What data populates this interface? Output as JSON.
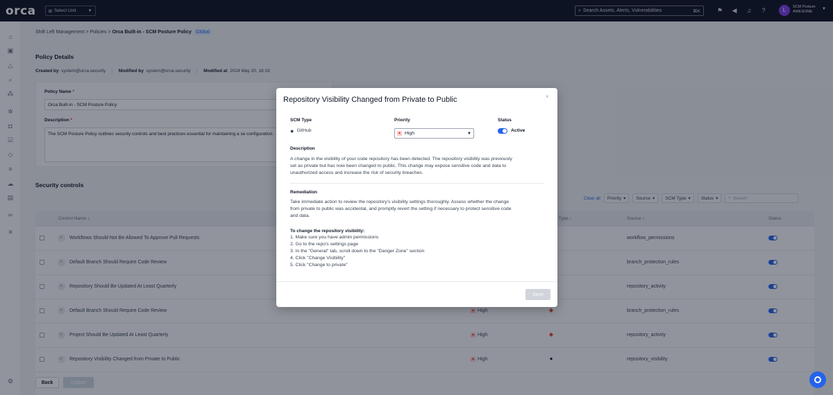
{
  "app": {
    "logo": "orca",
    "unit_select": "Select Unit"
  },
  "topbar": {
    "search_placeholder": "Search Assets, Alerts, Vulnerabilities",
    "search_shortcut": "⌘K",
    "user_initial": "L",
    "user_name": "SCM Posture",
    "user_org": "AWESOME"
  },
  "breadcrumb": {
    "item1": "Shift Left Management",
    "sep": ">",
    "item2": "Policies",
    "current": "Orca Built-in - SCM Posture Policy",
    "badge": "Global"
  },
  "policy_details": {
    "title": "Policy Details",
    "created_by_label": "Created by",
    "created_by": "system@orca.security",
    "modified_by_label": "Modified by",
    "modified_by": "system@orca.security",
    "modified_at_label": "Modified at",
    "modified_at": "2024 May 20, 18:18",
    "policy_name_label": "Policy Name",
    "policy_name": "Orca Built-in - SCM Posture Policy",
    "description_label": "Description",
    "description": "The SCM Posture Policy outlines security controls and best practices essential for maintaining a se configuration."
  },
  "security_controls": {
    "title": "Security controls",
    "clear_all": "Clear all",
    "filters": [
      "Priority",
      "Source",
      "SCM Type",
      "Status"
    ],
    "search_placeholder": "Search",
    "columns": {
      "name": "Control Name",
      "scm_type": "t Type",
      "source": "Source",
      "status": "Status"
    },
    "rows": [
      {
        "name": "Workflows Should Not Be Allowed To Approve Pull Requests",
        "priority": "",
        "scm_icon": "",
        "source": "workflow_permissions"
      },
      {
        "name": "Default Branch Should Require Code Review",
        "priority": "",
        "scm_icon": "",
        "source": "branch_protection_rules"
      },
      {
        "name": "Repository Should Be Updated At Least Quarterly",
        "priority": "",
        "scm_icon": "",
        "source": "repository_activity"
      },
      {
        "name": "Default Branch Should Require Code Review",
        "priority": "High",
        "scm_icon": "gitlab-icon",
        "source": "branch_protection_rules"
      },
      {
        "name": "Project Should Be Updated At Least Quarterly",
        "priority": "High",
        "scm_icon": "gitlab-icon",
        "source": "repository_activity"
      },
      {
        "name": "Repository Visibility Changed from Private to Public",
        "priority": "High",
        "scm_icon": "github-icon",
        "source": "repository_visibility"
      }
    ]
  },
  "footer": {
    "back": "Back",
    "update": "Update"
  },
  "modal": {
    "title": "Repository Visibility Changed from Private to Public",
    "close": "×",
    "scm_type_label": "SCM Type",
    "scm_type": "GitHub",
    "priority_label": "Priority",
    "priority": "High",
    "status_label": "Status",
    "status": "Active",
    "description_label": "Description",
    "description_lines": [
      "A change in the visibility of your code repository has been detected. The repository visibility was previously",
      "set as private but has now been changed to public. This change may expose sensitive code and data to",
      "unauthorized access and increase the risk of security breaches."
    ],
    "remediation_label": "Remediation",
    "remediation_lines": [
      "Take immediate action to review the repository's visibility settings thoroughly. Assess whether the change",
      "from private to public was accidental, and promptly revert the setting if necessary to protect sensitive code",
      "and data."
    ],
    "steps_title": "To change the repository visibility:",
    "steps": [
      "1. Make sure you have admin permissions",
      "2. Go to the repo's settings page",
      "3. In the \"General\" tab, scroll down to the \"Danger Zone\" section",
      "4. Click \"Change Visibility\"",
      "5. Click \"Change to private\""
    ],
    "save": "Save"
  },
  "colors": {
    "topbar": "#0b1020",
    "accent": "#2563eb",
    "priority_high": "#dc2626"
  }
}
